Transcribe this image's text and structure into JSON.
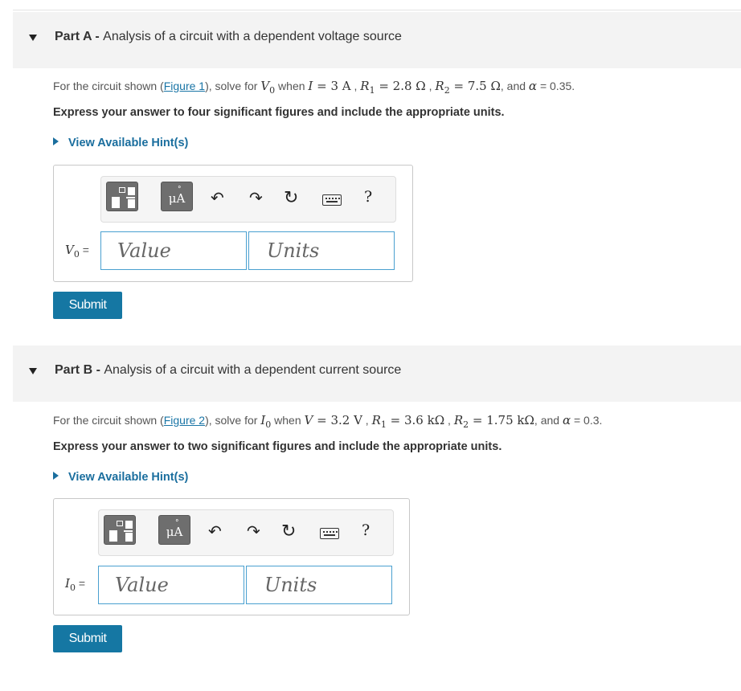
{
  "parts": [
    {
      "header_label": "Part A",
      "header_sep": " - ",
      "header_title": "Analysis of a circuit with a dependent voltage source",
      "problem": {
        "intro": "For the circuit shown (",
        "figure_link": "Figure 1",
        "after_link": "), solve for ",
        "target": "V",
        "target_sub": "0",
        "when": " when ",
        "source_var": "I",
        "source_val": " = 3 A",
        "r1_var": "R",
        "r1_sub": "1",
        "r1_val": " = 2.8 Ω",
        "r2_var": "R",
        "r2_sub": "2",
        "r2_val": " = 7.5 Ω",
        "and": ", and ",
        "alpha_var": "α",
        "alpha_val": " = 0.35."
      },
      "instruction": "Express your answer to four significant figures and include the appropriate units.",
      "hint_label": "View Available Hint(s)",
      "answer_var": "V",
      "answer_sub": "0",
      "answer_eq": " =",
      "value_placeholder": "Value",
      "units_placeholder": "Units",
      "submit_label": "Submit"
    },
    {
      "header_label": "Part B",
      "header_sep": " - ",
      "header_title": "Analysis of a circuit with a dependent current source",
      "problem": {
        "intro": "For the circuit shown (",
        "figure_link": "Figure 2",
        "after_link": "), solve for ",
        "target": "I",
        "target_sub": "0",
        "when": " when ",
        "source_var": "V",
        "source_val": " = 3.2 V",
        "r1_var": "R",
        "r1_sub": "1",
        "r1_val": " = 3.6 kΩ",
        "r2_var": "R",
        "r2_sub": "2",
        "r2_val": " = 1.75 kΩ",
        "and": ", and ",
        "alpha_var": "α",
        "alpha_val": " = 0.3."
      },
      "instruction": "Express your answer to two significant figures and include the appropriate units.",
      "hint_label": "View Available Hint(s)",
      "answer_var": "I",
      "answer_sub": "0",
      "answer_eq": " =",
      "value_placeholder": "Value",
      "units_placeholder": "Units",
      "submit_label": "Submit"
    }
  ],
  "toolbar": {
    "units_button_text": "μA",
    "units_button_ring": "°",
    "undo_glyph": "↶",
    "redo_glyph": "↷",
    "reset_glyph": "↻",
    "help_glyph": "?",
    "icons": [
      "templates-icon",
      "units-icon",
      "undo-icon",
      "redo-icon",
      "reset-icon",
      "keyboard-icon",
      "help-icon"
    ]
  },
  "colors": {
    "link": "#1a75a6",
    "submit_bg": "#1577a3",
    "header_bg": "#f3f3f3",
    "field_border": "#4aa0d0"
  }
}
